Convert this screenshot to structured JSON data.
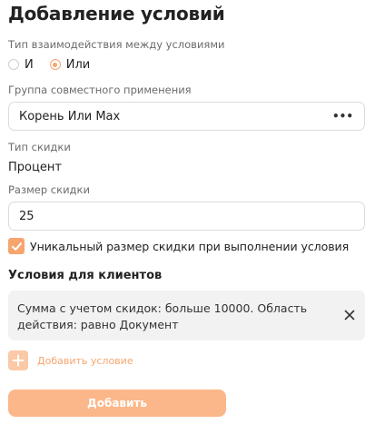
{
  "title": "Добавление условий",
  "interaction": {
    "label": "Тип взаимодействия между условиями",
    "options": [
      {
        "label": "И",
        "selected": false
      },
      {
        "label": "Или",
        "selected": true
      }
    ]
  },
  "group": {
    "label": "Группа совместного применения",
    "value": "Корень Или Max",
    "menu_glyph": "•••"
  },
  "discount_type": {
    "label": "Тип скидки",
    "value": "Процент"
  },
  "discount_size": {
    "label": "Размер скидки",
    "value": "25"
  },
  "unique_checkbox": {
    "label": "Уникальный размер скидки при выполнении условия",
    "checked": true
  },
  "client_conditions": {
    "heading": "Условия для клиентов",
    "items": [
      {
        "text": "Сумма с учетом скидок: больше 10000. Область действия: равно Документ"
      }
    ],
    "add_label": "Добавить условие"
  },
  "submit_label": "Добавить",
  "colors": {
    "accent": "#f7a56f",
    "accent_light": "#fbc9a7",
    "button": "#fbb789",
    "card_bg": "#f2f2f2"
  }
}
